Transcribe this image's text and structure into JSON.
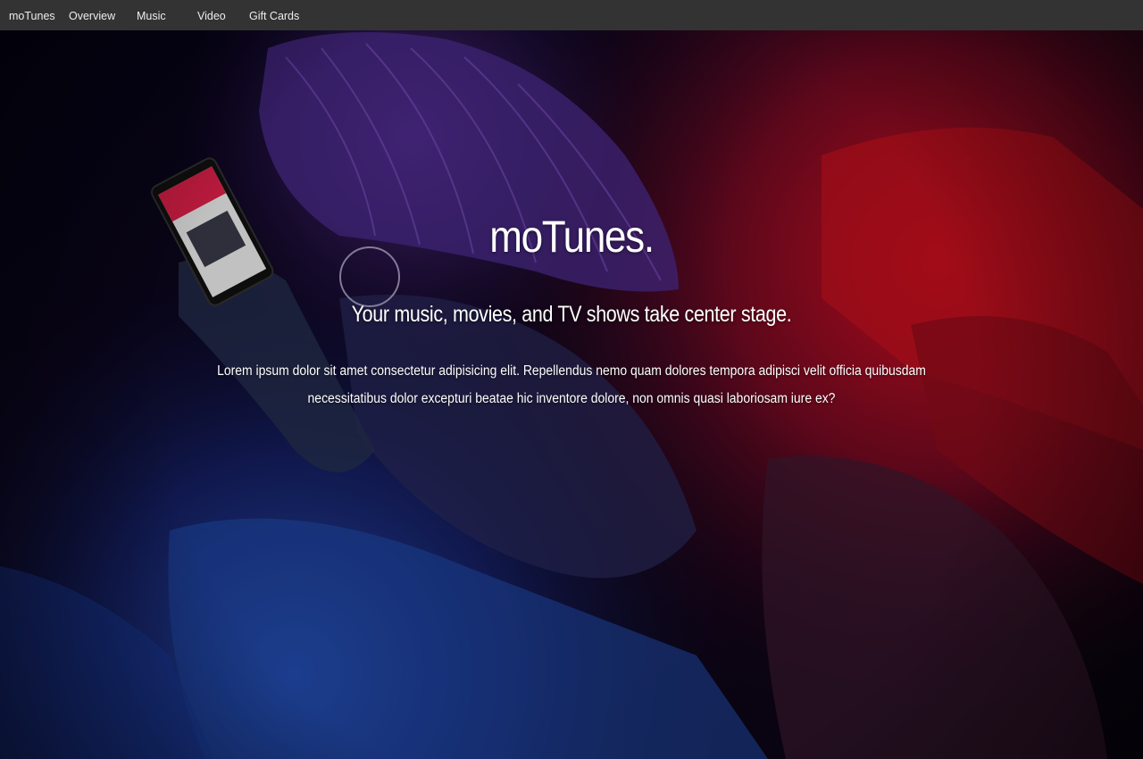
{
  "nav": {
    "brand": "moTunes",
    "items": [
      {
        "label": "Overview"
      },
      {
        "label": "Music"
      },
      {
        "label": "Video"
      },
      {
        "label": "Gift Cards"
      }
    ]
  },
  "hero": {
    "title": "moTunes.",
    "subtitle": "Your music, movies, and TV shows take center stage.",
    "body": "Lorem ipsum dolor sit amet consectetur adipisicing elit. Repellendus nemo quam dolores tempora adipisci velit officia quibusdam necessitatibus dolor excepturi beatae hic inventore dolore, non omnis quasi laboriosam iure ex?"
  },
  "colors": {
    "nav_background": "#333333",
    "nav_text": "#ededed",
    "hero_red": "#d0101c",
    "hero_blue": "#1a3aa8",
    "hero_dark": "#0a0818",
    "text": "#ffffff"
  }
}
